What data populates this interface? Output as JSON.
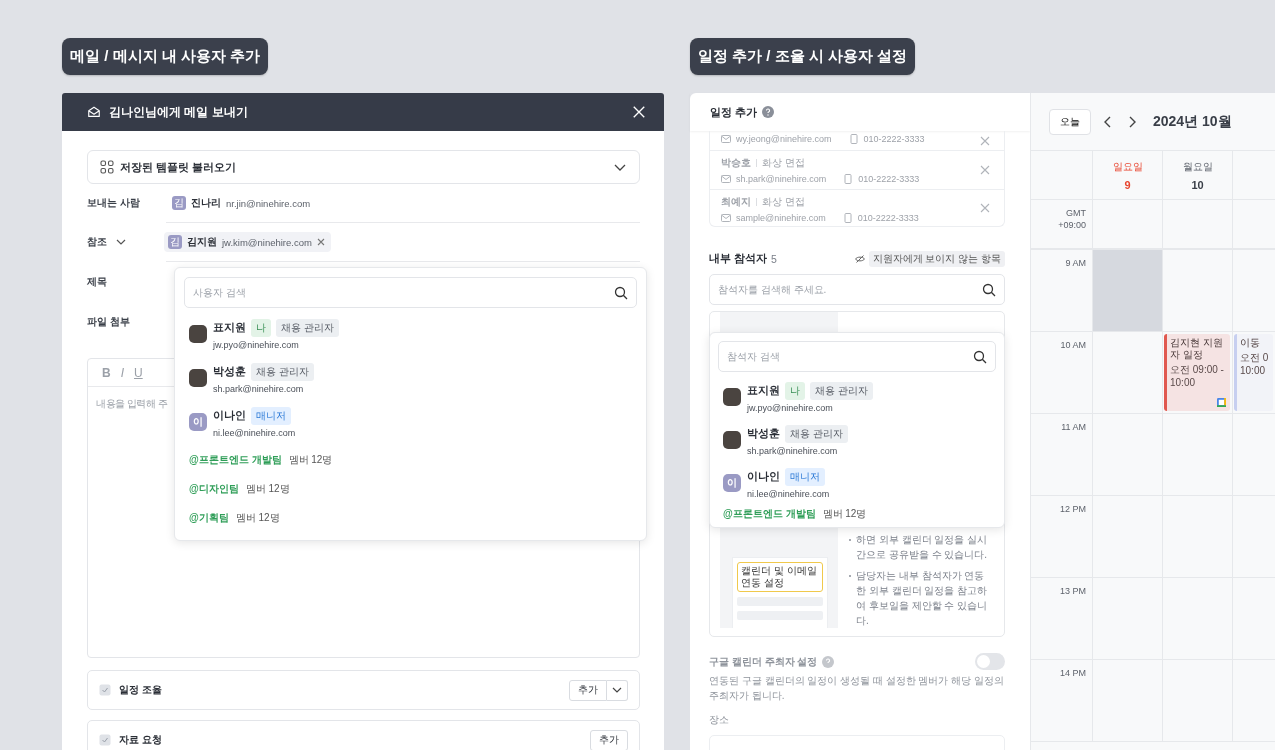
{
  "left_caption": "메일 / 메시지 내 사용자 추가",
  "right_caption": "일정 추가 / 조율 시 사용자 설정",
  "mail_modal": {
    "title": "김나인님에게 메일 보내기",
    "template_select": "저장된 템플릿 불러오기",
    "sender": {
      "label": "보내는 사람",
      "avatar": "김",
      "name": "진나리",
      "email": "nr.jin@ninehire.com"
    },
    "cc": {
      "label": "참조",
      "chips": [
        {
          "avatar": "김",
          "name": "김지원",
          "email": "jw.kim@ninehire.com"
        }
      ]
    },
    "subject_label": "제목",
    "attachment_label": "파일 첨부",
    "editor": {
      "toolbar": [
        {
          "label": "B",
          "kind": "bold"
        },
        {
          "label": "I",
          "kind": "italic"
        },
        {
          "label": "U",
          "kind": "underline"
        }
      ],
      "placeholder": "내용을 입력해 주"
    },
    "sections": [
      {
        "title": "일정 조율",
        "button": "추가",
        "has_menu": true
      },
      {
        "title": "자료 요청",
        "button": "추가",
        "has_menu": false
      }
    ],
    "user_dropdown": {
      "placeholder": "사용자 검색",
      "users": [
        {
          "name": "표지원",
          "badges": [
            {
              "label": "나",
              "kind": "me"
            },
            {
              "label": "채용 관리자",
              "kind": "role"
            }
          ],
          "email": "jw.pyo@ninehire.com"
        },
        {
          "name": "박성훈",
          "badges": [
            {
              "label": "채용 관리자",
              "kind": "role"
            }
          ],
          "email": "sh.park@ninehire.com"
        },
        {
          "initial": "이",
          "name": "이나인",
          "badges": [
            {
              "label": "매니저",
              "kind": "manager"
            }
          ],
          "email": "ni.lee@ninehire.com"
        }
      ],
      "teams": [
        {
          "name": "@프론트엔드 개발팀",
          "count": "멤버 12명"
        },
        {
          "name": "@디자인팀",
          "count": "멤버 12명"
        },
        {
          "name": "@기획팀",
          "count": "멤버 12명"
        }
      ]
    }
  },
  "schedule_panel": {
    "title": "일정 추가",
    "candidates": [
      {
        "email": "wy.jeong@ninehire.com",
        "phone": "010-2222-3333"
      },
      {
        "name": "박승호",
        "type": "화상 면접",
        "email": "sh.park@ninehire.com",
        "phone": "010-2222-3333"
      },
      {
        "name": "최예지",
        "type": "화상 면접",
        "email": "sample@ninehire.com",
        "phone": "010-2222-3333"
      }
    ],
    "attendees_label": "내부 참석자",
    "attendees_count": "5",
    "hidden_tag": "지원자에게 보이지 않는 항목",
    "search_placeholder": "참석자를 검색해 주세요.",
    "attendee_dropdown": {
      "placeholder": "참석자 검색",
      "users": [
        {
          "name": "표지원",
          "badges": [
            {
              "label": "나",
              "kind": "me"
            },
            {
              "label": "채용 관리자",
              "kind": "role"
            }
          ],
          "email": "jw.pyo@ninehire.com"
        },
        {
          "name": "박성훈",
          "badges": [
            {
              "label": "채용 관리자",
              "kind": "role"
            }
          ],
          "email": "sh.park@ninehire.com"
        },
        {
          "initial": "이",
          "name": "이나인",
          "badges": [
            {
              "label": "매니저",
              "kind": "manager"
            }
          ],
          "email": "ni.lee@ninehire.com"
        }
      ],
      "teams": [
        {
          "name": "@프론트엔드 개발팀",
          "count": "멤버 12명"
        }
      ]
    },
    "info_card": {
      "illustration_label": "캘린더 및 이메일 연동 설정",
      "bullets": [
        "하면 외부 캘린더 일정을 실시간으로 공유받을 수 있습니다.",
        "담당자는 내부 참석자가 연동한 외부 캘린더 일정을 참고하여 후보일을 제안할 수 있습니다."
      ]
    },
    "host_setting": {
      "label": "구글 캘린더 주최자 설정",
      "on": false,
      "description": "연동된 구글 캘린더의 일정이 생성될 때 설정한 멤버가 해당 일정의 주최자가 됩니다."
    },
    "location_label": "장소"
  },
  "calendar": {
    "today_button": "오늘",
    "month": "2024년 10월",
    "days": [
      {
        "weekday": "일요일",
        "date": "9",
        "kind": "sunday"
      },
      {
        "weekday": "월요일",
        "date": "10",
        "kind": "weekday"
      }
    ],
    "timezone": "GMT +09:00",
    "hours": [
      {
        "label": "9 AM",
        "cells": [
          {
            "shaded": true
          },
          {
            "shaded": false
          },
          {
            "shaded": false
          }
        ]
      },
      {
        "label": "10 AM",
        "cells": [
          {
            "shaded": false
          },
          {
            "event": {
              "title": "김지현 지원자 일정",
              "time": "오전 09:00 - 10:00",
              "color": "#e0584f",
              "google": true
            }
          },
          {
            "event": {
              "title": "이동",
              "time": "오전 0 10:00",
              "color": "#c7cff0",
              "google": false
            }
          }
        ]
      },
      {
        "label": "11 AM",
        "cells": [
          {
            "shaded": false
          },
          {
            "shaded": false
          },
          {
            "shaded": false
          }
        ]
      },
      {
        "label": "12 PM",
        "cells": [
          {
            "shaded": false
          },
          {
            "shaded": false
          },
          {
            "shaded": false
          }
        ]
      },
      {
        "label": "13 PM",
        "cells": [
          {
            "shaded": false
          },
          {
            "shaded": false
          },
          {
            "shaded": false
          }
        ]
      },
      {
        "label": "14 PM",
        "cells": [
          {
            "shaded": false
          },
          {
            "shaded": false
          },
          {
            "shaded": false
          }
        ]
      }
    ]
  }
}
